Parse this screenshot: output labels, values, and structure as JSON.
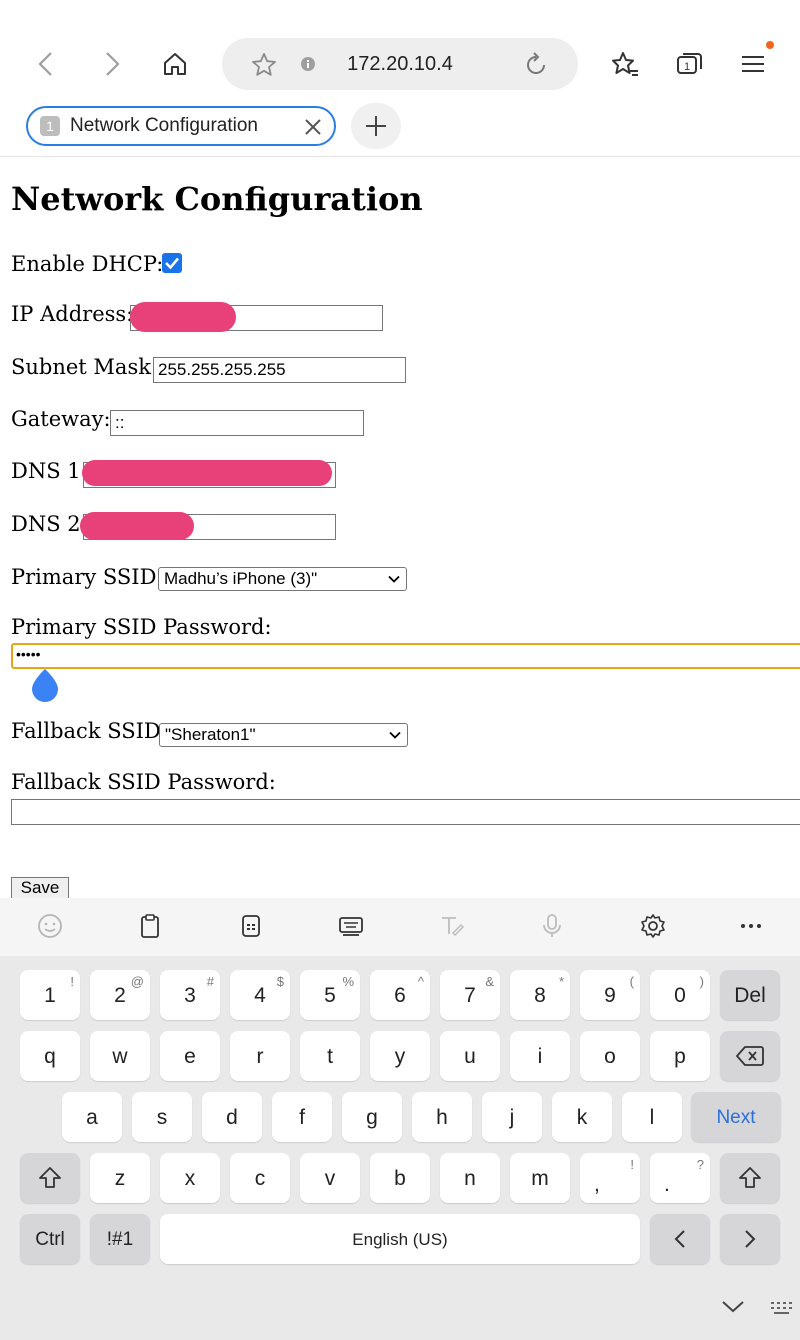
{
  "browser": {
    "url": "172.20.10.4",
    "tab_number": "1",
    "tab_title": "Network Configuration",
    "tab_count": "1"
  },
  "page": {
    "title": "Network Configuration",
    "dhcp_label": "Enable DHCP:",
    "dhcp_checked": true,
    "ip_label": "IP Address:",
    "subnet_label": "Subnet Mask:",
    "subnet_value": "255.255.255.255",
    "gateway_label": "Gateway:",
    "gateway_value": "::",
    "dns1_label": "DNS 1:",
    "dns2_label": "DNS 2:",
    "primary_ssid_label": "Primary SSID:",
    "primary_ssid_value": "Madhu’s iPhone (3)\"",
    "primary_pw_label": "Primary SSID Password:",
    "primary_pw_value": "•••••",
    "fallback_ssid_label": "Fallback SSID:",
    "fallback_ssid_value": "\"Sheraton1\"",
    "fallback_pw_label": "Fallback SSID Password:",
    "save_label": "Save"
  },
  "keyboard": {
    "row1": [
      {
        "k": "1",
        "s": "!"
      },
      {
        "k": "2",
        "s": "@"
      },
      {
        "k": "3",
        "s": "#"
      },
      {
        "k": "4",
        "s": "$"
      },
      {
        "k": "5",
        "s": "%"
      },
      {
        "k": "6",
        "s": "^"
      },
      {
        "k": "7",
        "s": "&"
      },
      {
        "k": "8",
        "s": "*"
      },
      {
        "k": "9",
        "s": "("
      },
      {
        "k": "0",
        "s": ")"
      }
    ],
    "row2": [
      "q",
      "w",
      "e",
      "r",
      "t",
      "y",
      "u",
      "i",
      "o",
      "p"
    ],
    "row3": [
      "a",
      "s",
      "d",
      "f",
      "g",
      "h",
      "j",
      "k",
      "l"
    ],
    "row4": [
      "z",
      "x",
      "c",
      "v",
      "b",
      "n",
      "m"
    ],
    "del_label": "Del",
    "next_label": "Next",
    "ctrl_label": "Ctrl",
    "sym_label": "!#1",
    "space_label": "English (US)",
    "comma_sub": "!",
    "period_sub": "?",
    "accent_color": "#2a6fdb"
  }
}
